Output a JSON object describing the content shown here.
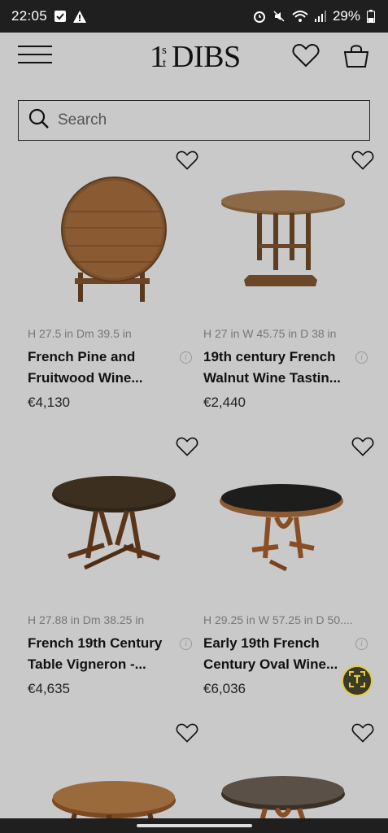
{
  "status": {
    "time": "22:05",
    "battery": "29%",
    "icons": [
      "check-box-icon",
      "warning-icon",
      "alarm-icon",
      "mute-icon",
      "wifi-icon",
      "signal-icon",
      "battery-icon"
    ]
  },
  "header": {
    "logo": "1stDIBS",
    "menu_icon": "hamburger-icon",
    "favorites_icon": "heart-icon",
    "cart_icon": "bag-icon"
  },
  "search": {
    "placeholder": "Search"
  },
  "colors": {
    "background": "#c9c9c9",
    "dim_underline": "#6aa0e8",
    "accent_fab": "#e8c93a"
  },
  "products": [
    {
      "dims_parts": [
        "H ",
        "27.5 in",
        " Dm ",
        "39.5 in"
      ],
      "title_line1": "French Pine and",
      "title_line2": "Fruitwood Wine...",
      "price": "€4,130"
    },
    {
      "dims_parts": [
        "H ",
        "27 in",
        " W ",
        "45.75 in",
        " D ",
        "38 in"
      ],
      "title_line1": "19th century French",
      "title_line2": "Walnut Wine Tastin...",
      "price": "€2,440"
    },
    {
      "dims_parts": [
        "H ",
        "27.88 in",
        " Dm ",
        "38.25 in"
      ],
      "title_line1": "French 19th Century",
      "title_line2": "Table Vigneron -...",
      "price": "€4,635"
    },
    {
      "dims_parts": [
        "H 29.",
        "25 in",
        " W 57.",
        "25 in",
        " D 50...."
      ],
      "title_line1": "Early 19th French",
      "title_line2": "Century Oval Wine...",
      "price": "€6,036"
    }
  ]
}
